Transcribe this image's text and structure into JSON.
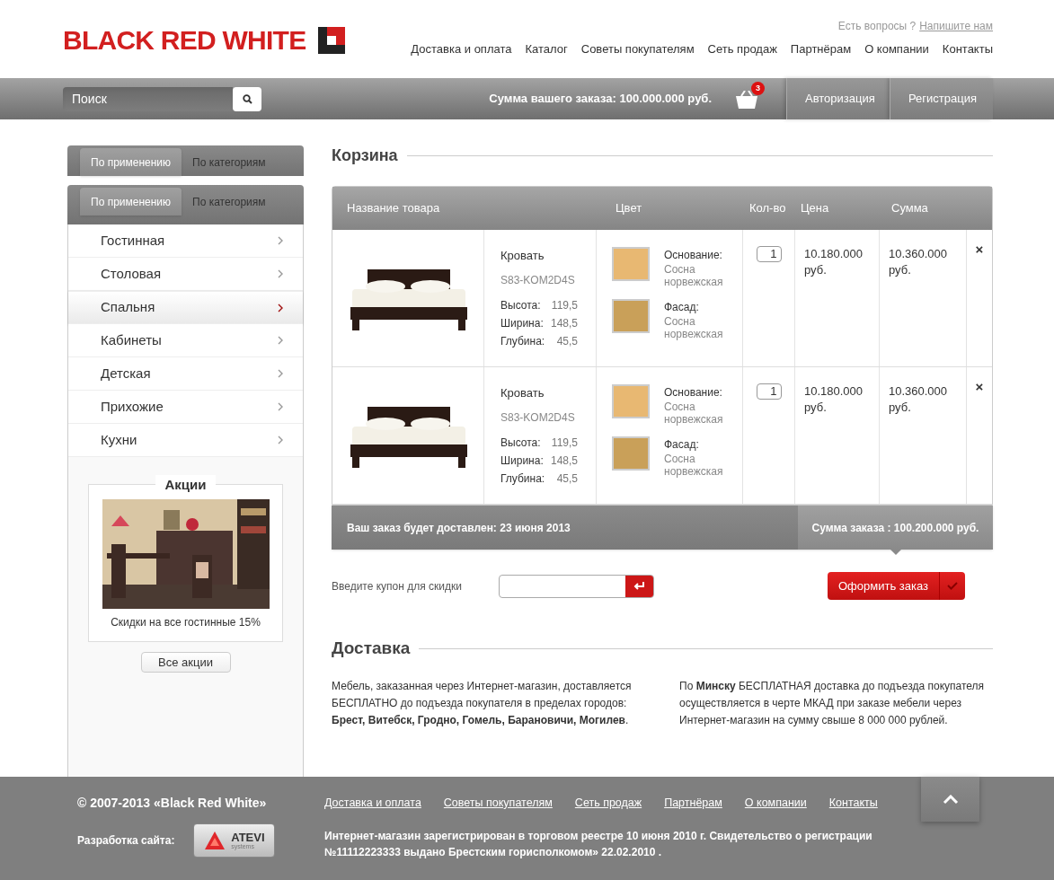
{
  "header": {
    "logo": "BLACK RED WHITE",
    "question": "Есть вопросы ?",
    "contact_link": "Напишите нам",
    "nav": [
      "Доставка и оплата",
      "Каталог",
      "Советы покупателям",
      "Сеть продаж",
      "Партнёрам",
      "О компании",
      "Контакты"
    ]
  },
  "toolbar": {
    "search": {
      "placeholder": "Поиск"
    },
    "order_sum": "Сумма вашего заказа: 100.000.000 руб.",
    "cart_count": "3",
    "buttons": [
      "Авторизация",
      "Регистрация"
    ]
  },
  "sidebar": {
    "tab_bars": [
      [
        {
          "label": "По применению",
          "selected": true
        },
        {
          "label": "По категориям",
          "selected": false
        }
      ],
      [
        {
          "label": "По применению",
          "selected": true
        },
        {
          "label": "По категориям",
          "selected": false
        }
      ]
    ],
    "items": [
      {
        "label": "Гостинная",
        "selected": false
      },
      {
        "label": "Столовая",
        "selected": false
      },
      {
        "label": "Спальня",
        "selected": true
      },
      {
        "label": "Кабинеты",
        "selected": false
      },
      {
        "label": "Детская",
        "selected": false
      },
      {
        "label": "Прихожие",
        "selected": false
      },
      {
        "label": "Кухни",
        "selected": false
      }
    ],
    "promo": {
      "title": "Акции",
      "caption": "Скидки на все гостинные 15%",
      "button": "Все акции"
    }
  },
  "cart": {
    "title": "Корзина",
    "columns": [
      "Название товара",
      "Цвет",
      "Кол-во",
      "Цена",
      "Сумма"
    ],
    "rows": [
      {
        "name": "Кровать",
        "sku": "S83-KOM2D4S",
        "dims": [
          {
            "label": "Высота:",
            "value": "119,5"
          },
          {
            "label": "Ширина:",
            "value": "148,5"
          },
          {
            "label": "Глубина:",
            "value": "45,5"
          }
        ],
        "colors": [
          {
            "label": "Основание:",
            "value": "Сосна норвежская",
            "color": "#e8b872"
          },
          {
            "label": "Фасад:",
            "value": "Сосна норвежская",
            "color": "#c9a059"
          }
        ],
        "qty": "1",
        "price": "10.180.000 руб.",
        "sum": "10.360.000 руб.",
        "remove": "×"
      },
      {
        "name": "Кровать",
        "sku": "S83-KOM2D4S",
        "dims": [
          {
            "label": "Высота:",
            "value": "119,5"
          },
          {
            "label": "Ширина:",
            "value": "148,5"
          },
          {
            "label": "Глубина:",
            "value": "45,5"
          }
        ],
        "colors": [
          {
            "label": "Основание:",
            "value": "Сосна норвежская",
            "color": "#e8b872"
          },
          {
            "label": "Фасад:",
            "value": "Сосна норвежская",
            "color": "#c9a059"
          }
        ],
        "qty": "1",
        "price": "10.180.000 руб.",
        "sum": "10.360.000 руб.",
        "remove": "×"
      }
    ],
    "delivery_note": "Ваш заказ будет доставлен: 23 июня 2013",
    "total": "Сумма заказа : 100.200.000 руб.",
    "coupon_label": "Введите купон для скидки",
    "checkout": "Оформить заказ"
  },
  "delivery": {
    "title": "Доставка",
    "paragraphs": [
      "Мебель, заказанная через Интернет-магазин, доставляется БЕСПЛАТНО до подъезда покупателя в пределах городов: **Брест, Витебск, Гродно, Гомель, Барановичи, Могилев**.",
      "По **Минску** БЕСПЛАТНАЯ доставка до подъезда покупателя осуществляется в черте МКАД при заказе мебели через Интернет-магазин на сумму свыше 8 000 000 рублей."
    ]
  },
  "footer": {
    "copyright": "© 2007-2013 «Black Red White»",
    "dev_label": "Разработка сайта:",
    "dev_logo": {
      "name": "ATEVI",
      "sub": "systems"
    },
    "links": [
      "Доставка и оплата",
      "Советы покупателям",
      "Сеть продаж",
      "Партнёрам",
      "О компании",
      "Контакты"
    ],
    "info": "Интернет-магазин зарегистрирован в торговом реестре 10 июня 2010 г. Свидетельство о регистрации №11112223333 выдано Брестским горисполкомом» 22.02.2010 ."
  }
}
